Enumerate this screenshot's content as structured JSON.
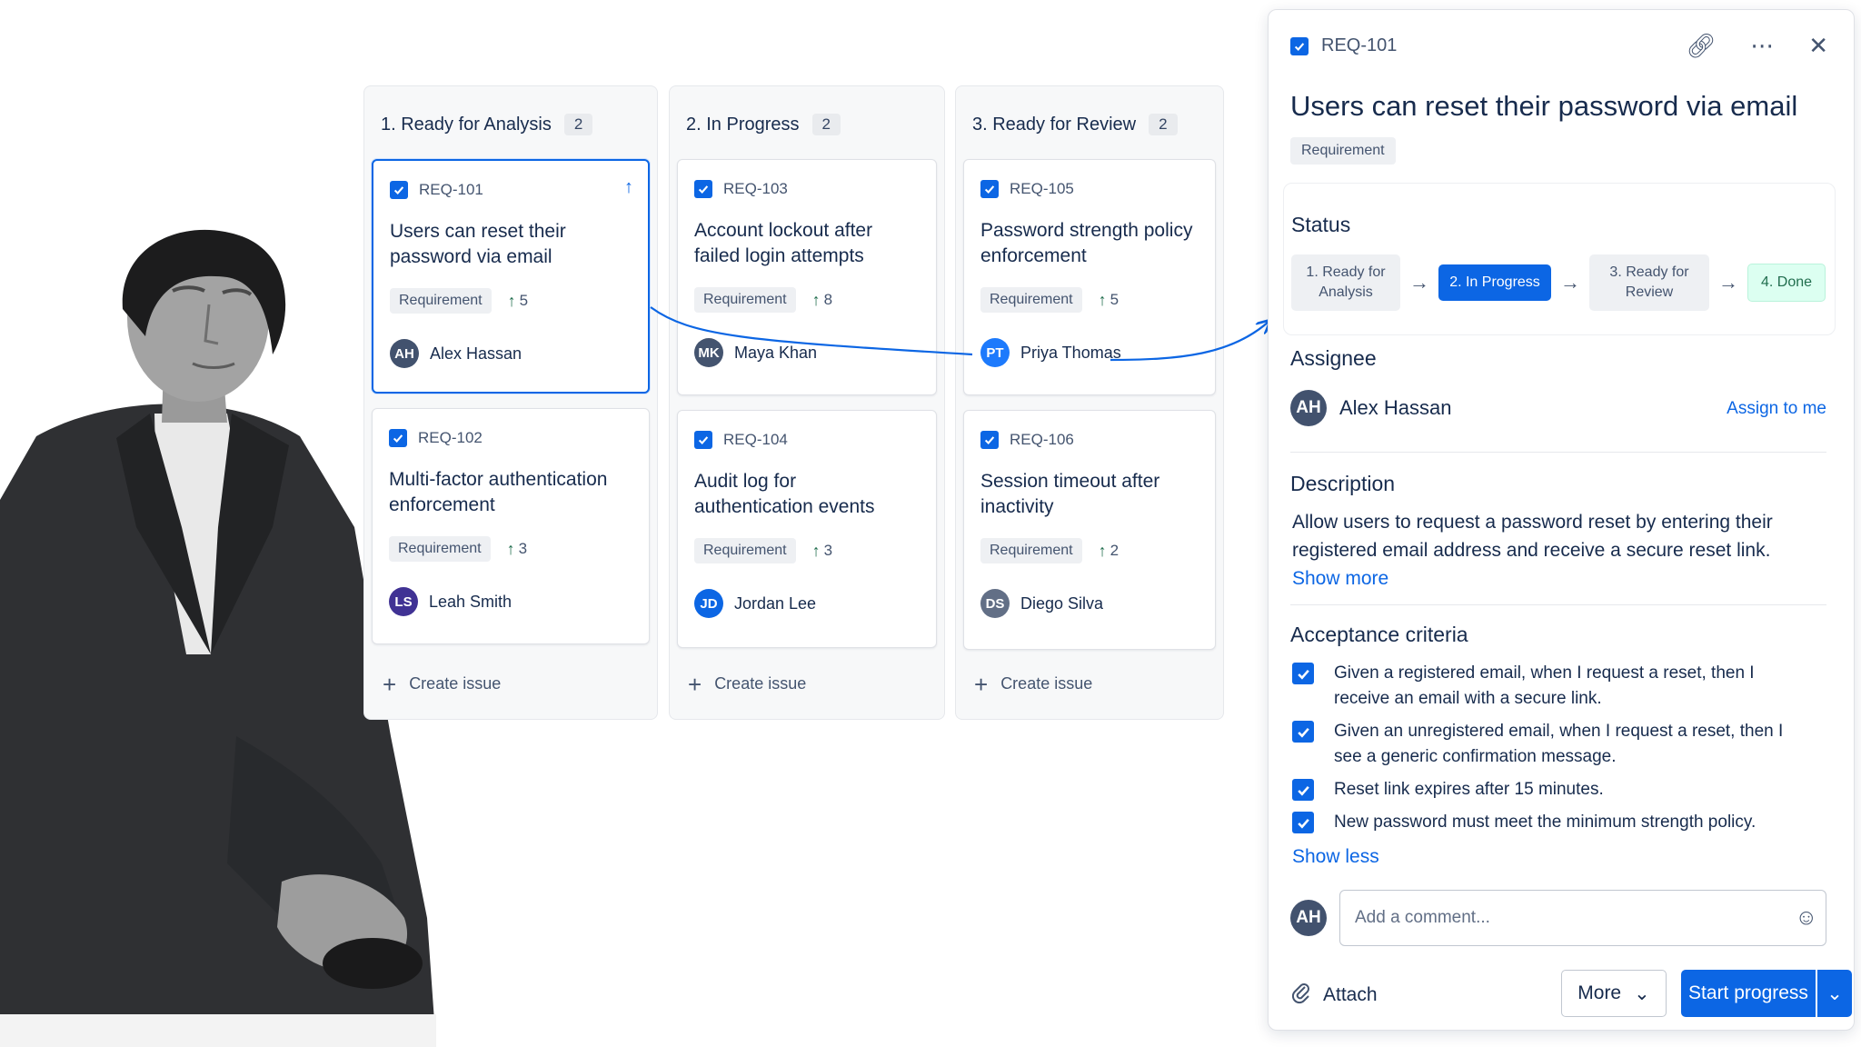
{
  "board": {
    "columns": [
      {
        "title": "1. Ready for Analysis",
        "count": "2",
        "create_label": "Create issue",
        "cards": [
          {
            "key": "REQ-101",
            "title": "Users can reset their password via email",
            "tag": "Requirement",
            "votes": "5",
            "initials": "AH",
            "assignee": "Alex Hassan",
            "avatar_color": "#42526e"
          },
          {
            "key": "REQ-102",
            "title": "Multi-factor authentication enforcement",
            "tag": "Requirement",
            "votes": "3",
            "initials": "LS",
            "assignee": "Leah Smith",
            "avatar_color": "#403294"
          }
        ]
      },
      {
        "title": "2. In Progress",
        "count": "2",
        "create_label": "Create issue",
        "cards": [
          {
            "key": "REQ-103",
            "title": "Account lockout after failed login attempts",
            "tag": "Requirement",
            "votes": "8",
            "initials": "MK",
            "assignee": "Maya Khan",
            "avatar_color": "#44546f"
          },
          {
            "key": "REQ-104",
            "title": "Audit log for authentication events",
            "tag": "Requirement",
            "votes": "3",
            "initials": "JD",
            "assignee": "Jordan Lee",
            "avatar_color": "#0c66e4"
          }
        ]
      },
      {
        "title": "3. Ready for Review",
        "count": "2",
        "create_label": "Create issue",
        "cards": [
          {
            "key": "REQ-105",
            "title": "Password strength policy enforcement",
            "tag": "Requirement",
            "votes": "5",
            "initials": "PT",
            "assignee": "Priya Thomas",
            "avatar_color": "#1d7afc"
          },
          {
            "key": "REQ-106",
            "title": "Session timeout after inactivity",
            "tag": "Requirement",
            "votes": "2",
            "initials": "DS",
            "assignee": "Diego Silva",
            "avatar_color": "#626f86"
          }
        ]
      }
    ]
  },
  "panel": {
    "key": "REQ-101",
    "title": "Users can reset their password via email",
    "tag": "Requirement",
    "status": {
      "heading": "Status",
      "steps": [
        "1. Ready for Analysis",
        "2. In Progress",
        "3. Ready for Review",
        "4. Done"
      ],
      "current": "2. In Progress"
    },
    "assignee": {
      "heading": "Assignee",
      "initials": "AH",
      "name": "Alex Hassan",
      "assign_me": "Assign to me"
    },
    "description": {
      "heading": "Description",
      "text": "Allow users to request a password reset by entering their registered email address and receive a secure reset link.",
      "show_more": "Show more"
    },
    "acceptance": {
      "heading": "Acceptance criteria",
      "items": [
        "Given a registered email, when I request a reset, then I receive an email with a secure link.",
        "Given an unregistered email, when I request a reset, then I see a generic confirmation message.",
        "Reset link expires after 15 minutes.",
        "New password must meet the minimum strength policy."
      ],
      "show_less": "Show less"
    },
    "comment": {
      "initials": "AH",
      "placeholder": "Add a comment..."
    },
    "footer": {
      "attach": "Attach",
      "more": "More",
      "start": "Start progress"
    }
  },
  "colors": {
    "brand": "#0c66e4",
    "text": "#172b4d",
    "done_bg": "#dcfff1",
    "done_text": "#216e4e"
  }
}
